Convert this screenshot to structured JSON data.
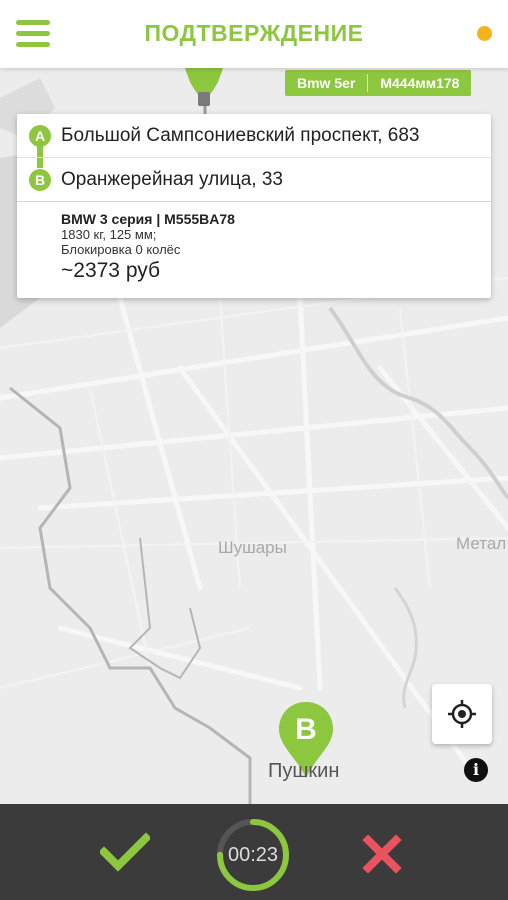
{
  "header": {
    "title": "ПОДТВЕРЖДЕНИЕ"
  },
  "vehicle_tag": {
    "model": "Bmw 5er",
    "plate": "M444мм178"
  },
  "route": {
    "point_a_letter": "A",
    "point_a_address": "Большой Сампсониевский проспект, 683",
    "point_b_letter": "B",
    "point_b_address": "Оранжерейная улица, 33"
  },
  "vehicle_details": {
    "car": "BMW 3 серия | M555BA78",
    "weight_clearance": "1830 кг, 125 мм;",
    "wheel_lock": "Блокировка 0 колёс",
    "price": "~2373 руб"
  },
  "map": {
    "labels": {
      "shushary": "Шушары",
      "metal": "Метал",
      "pushkin": "Пушкин"
    },
    "pin_b_letter": "B"
  },
  "timer": {
    "value": "00:23",
    "progress": 0.75
  },
  "colors": {
    "accent": "#8dc63f",
    "status_dot": "#f6b21c",
    "cancel": "#e8535f",
    "bottom_bar": "#3b3b3b"
  },
  "icons": {
    "menu": "hamburger-menu-icon",
    "locate": "locate-crosshair-icon",
    "info": "info-icon",
    "confirm": "checkmark-icon",
    "cancel": "close-icon"
  }
}
